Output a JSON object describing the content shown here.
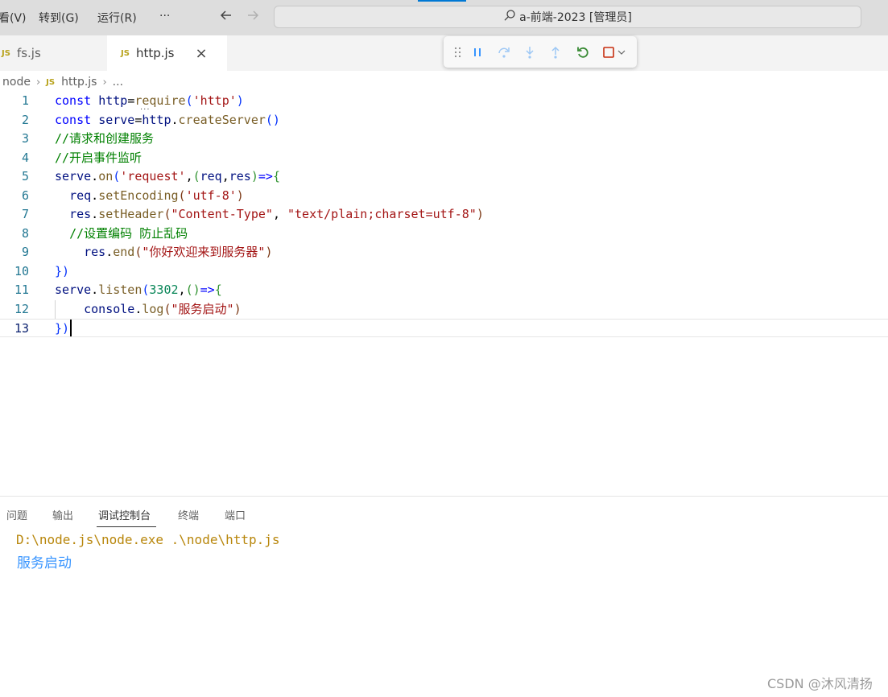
{
  "menu": [
    "看(V)",
    "转到(G)",
    "运行(R)",
    "···"
  ],
  "nav": {
    "back_icon": "arrow-left-icon",
    "forward_icon": "arrow-right-icon"
  },
  "command_center": {
    "icon": "search-icon",
    "title": "a-前端-2023 [管理员]"
  },
  "tabs": [
    {
      "badge": "JS",
      "label": "fs.js",
      "active": false
    },
    {
      "badge": "JS",
      "label": "http.js",
      "active": true,
      "close": "×"
    }
  ],
  "debug_toolbar": {
    "items": [
      "drag-handle-icon",
      "pause-icon",
      "step-over-icon",
      "step-into-icon",
      "step-out-icon",
      "restart-icon",
      "stop-icon",
      "chevron-down-icon"
    ],
    "colors": {
      "blue": "#3794ff",
      "green": "#388a34",
      "red": "#c72e0f"
    }
  },
  "breadcrumb": [
    "node",
    "JS",
    "http.js",
    "..."
  ],
  "editor": {
    "line_numbers": [
      "1",
      "2",
      "3",
      "4",
      "5",
      "6",
      "7",
      "8",
      "9",
      "10",
      "11",
      "12",
      "13"
    ],
    "lines": [
      [
        [
          "kw",
          "const"
        ],
        [
          "pl",
          " "
        ],
        [
          "var",
          "http"
        ],
        [
          "pl",
          "="
        ],
        [
          "fn",
          "require"
        ],
        [
          "br1",
          "("
        ],
        [
          "str",
          "'http'"
        ],
        [
          "br1",
          ")"
        ]
      ],
      [
        [
          "kw",
          "const"
        ],
        [
          "pl",
          " "
        ],
        [
          "var",
          "serve"
        ],
        [
          "pl",
          "="
        ],
        [
          "var",
          "http"
        ],
        [
          "pl",
          "."
        ],
        [
          "fn",
          "createServer"
        ],
        [
          "br1",
          "()"
        ]
      ],
      [
        [
          "cmt",
          "//请求和创建服务"
        ]
      ],
      [
        [
          "cmt",
          "//开启事件监听"
        ]
      ],
      [
        [
          "var",
          "serve"
        ],
        [
          "pl",
          "."
        ],
        [
          "fn",
          "on"
        ],
        [
          "br1",
          "("
        ],
        [
          "str",
          "'request'"
        ],
        [
          "pl",
          ","
        ],
        [
          "br2",
          "("
        ],
        [
          "var",
          "req"
        ],
        [
          "pl",
          ","
        ],
        [
          "var",
          "res"
        ],
        [
          "br2",
          ")"
        ],
        [
          "kw",
          "=>"
        ],
        [
          "br2",
          "{"
        ]
      ],
      [
        [
          "pl",
          "  "
        ],
        [
          "var",
          "req"
        ],
        [
          "pl",
          "."
        ],
        [
          "fn",
          "setEncoding"
        ],
        [
          "br3",
          "("
        ],
        [
          "str",
          "'utf-8'"
        ],
        [
          "br3",
          ")"
        ]
      ],
      [
        [
          "pl",
          "  "
        ],
        [
          "var",
          "res"
        ],
        [
          "pl",
          "."
        ],
        [
          "fn",
          "setHeader"
        ],
        [
          "br3",
          "("
        ],
        [
          "str",
          "\"Content-Type\""
        ],
        [
          "pl",
          ", "
        ],
        [
          "str",
          "\"text/plain;charset=utf-8\""
        ],
        [
          "br3",
          ")"
        ]
      ],
      [
        [
          "pl",
          "  "
        ],
        [
          "cmt",
          "//设置编码 防止乱码"
        ]
      ],
      [
        [
          "pl",
          "    "
        ],
        [
          "var",
          "res"
        ],
        [
          "pl",
          "."
        ],
        [
          "fn",
          "end"
        ],
        [
          "br3",
          "("
        ],
        [
          "str",
          "\"你好欢迎来到服务器\""
        ],
        [
          "br3",
          ")"
        ]
      ],
      [
        [
          "br1",
          "})"
        ]
      ],
      [
        [
          "var",
          "serve"
        ],
        [
          "pl",
          "."
        ],
        [
          "fn",
          "listen"
        ],
        [
          "br1",
          "("
        ],
        [
          "num",
          "3302"
        ],
        [
          "pl",
          ","
        ],
        [
          "br2",
          "()"
        ],
        [
          "kw",
          "=>"
        ],
        [
          "br2",
          "{"
        ]
      ],
      [
        [
          "pl",
          "    "
        ],
        [
          "var",
          "console"
        ],
        [
          "pl",
          "."
        ],
        [
          "fn",
          "log"
        ],
        [
          "br3",
          "("
        ],
        [
          "str",
          "\"服务启动\""
        ],
        [
          "br3",
          ")"
        ]
      ],
      [
        [
          "br1",
          "})"
        ]
      ]
    ]
  },
  "panel": {
    "tabs": [
      "问题",
      "输出",
      "调试控制台",
      "终端",
      "端口"
    ],
    "active_tab": "调试控制台",
    "console": [
      {
        "text": "D:\\node.js\\node.exe .\\node\\http.js",
        "color": "#b8860b"
      },
      {
        "text": "服务启动",
        "color": "#3794ff"
      }
    ]
  },
  "watermark": "CSDN @沐风清扬"
}
